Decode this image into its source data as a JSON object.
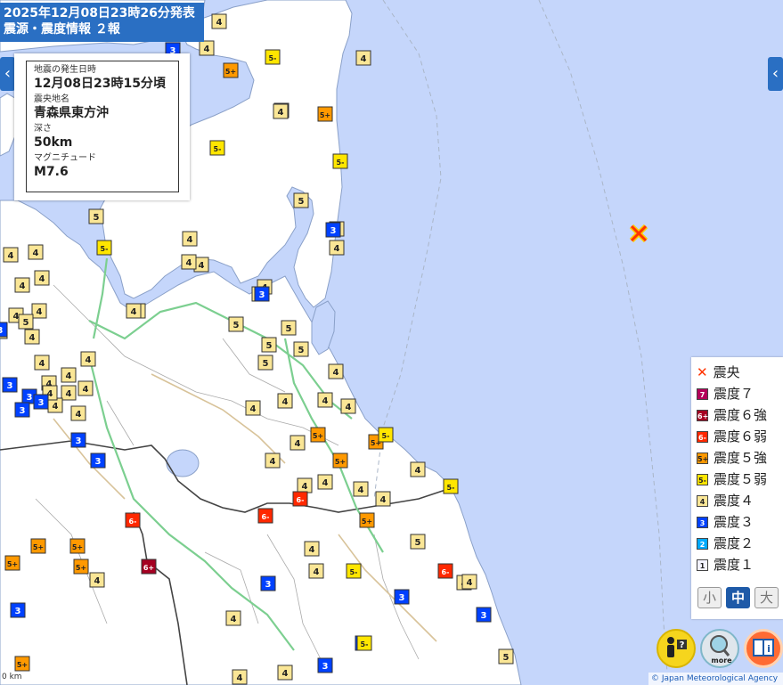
{
  "header": {
    "line1": "2025年12月08日23時26分発表",
    "line2": "震源・震度情報 ２報"
  },
  "info": {
    "time_label": "地震の発生日時",
    "time_value": "12月08日23時15分頃",
    "place_label": "震央地名",
    "place_value": "青森県東方沖",
    "depth_label": "深さ",
    "depth_value": "50km",
    "mag_label": "マグニチュード",
    "mag_value": "M7.6"
  },
  "legend": [
    {
      "label": "震央",
      "code": "epicenter"
    },
    {
      "label": "震度７",
      "code": "7",
      "color": "#b4005a",
      "text_color": "#fff"
    },
    {
      "label": "震度６強",
      "code": "6+",
      "color": "#a50021",
      "text_color": "#fff"
    },
    {
      "label": "震度６弱",
      "code": "6-",
      "color": "#ff2800",
      "text_color": "#fff"
    },
    {
      "label": "震度５強",
      "code": "5+",
      "color": "#ff9900",
      "text_color": "#222"
    },
    {
      "label": "震度５弱",
      "code": "5-",
      "color": "#ffe600",
      "text_color": "#222"
    },
    {
      "label": "震度４",
      "code": "4",
      "color": "#fae696",
      "text_color": "#222"
    },
    {
      "label": "震度３",
      "code": "3",
      "color": "#0041ff",
      "text_color": "#fff"
    },
    {
      "label": "震度２",
      "code": "2",
      "color": "#00aaff",
      "text_color": "#fff"
    },
    {
      "label": "震度１",
      "code": "1",
      "color": "#f2f2ff",
      "text_color": "#222"
    }
  ],
  "size_buttons": [
    "小",
    "中",
    "大"
  ],
  "size_active": "中",
  "buttons": {
    "help_label": "?",
    "more_label": "more",
    "info_label": "i"
  },
  "copyright": "© Japan Meteorological Agency",
  "scale_label": "0 km",
  "nav": {
    "left": "‹",
    "right": "‹"
  },
  "colors": {
    "sea": "#c5d6fb",
    "land": "#ffffff",
    "header_bg": "#2a6fc3",
    "epicenter": "#ff3300"
  },
  "intensities": [
    "3",
    "4",
    "5+",
    "5-",
    "4",
    "5+",
    "5+",
    "5-",
    "5-",
    "5",
    "5",
    "4",
    "4",
    "5-",
    "4",
    "4",
    "4",
    "4",
    "4",
    "4",
    "4",
    "4",
    "4",
    "4",
    "4",
    "5",
    "5",
    "5",
    "5",
    "5",
    "5",
    "5",
    "4",
    "4",
    "4",
    "4",
    "4",
    "4",
    "4",
    "4",
    "4",
    "3",
    "3",
    "3",
    "3",
    "3",
    "4",
    "4",
    "4",
    "4",
    "3",
    "4",
    "4",
    "5+",
    "5+",
    "4",
    "4",
    "4",
    "5+",
    "5+",
    "5-",
    "4",
    "5-",
    "4",
    "6-",
    "6-",
    "6-",
    "5+",
    "5+",
    "5+",
    "5+",
    "4",
    "6+",
    "4",
    "4",
    "5-",
    "5",
    "6-",
    "4",
    "4",
    "3",
    "3",
    "3",
    "4",
    "3",
    "3",
    "3",
    "4",
    "4",
    "5",
    "5+",
    "4",
    "4",
    "4",
    "4",
    "5-",
    "4",
    "4",
    "3",
    "3",
    "3",
    "4",
    "4",
    "4",
    "4",
    "4",
    "4",
    "4",
    "5-",
    "4",
    "4",
    "4"
  ]
}
